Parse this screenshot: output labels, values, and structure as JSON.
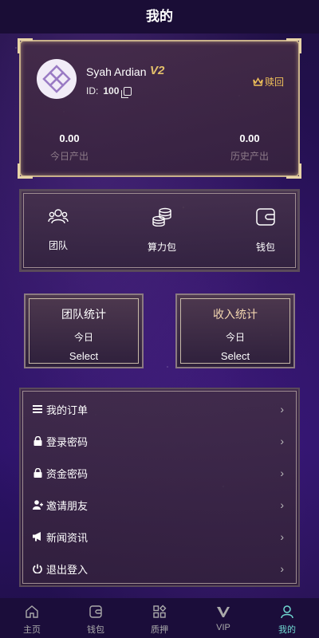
{
  "header": {
    "title": "我的"
  },
  "profile": {
    "name": "Syah Ardian",
    "vip_level": "V2",
    "id_label": "ID:",
    "id_value": "100",
    "reback_label": "赎回",
    "stats": [
      {
        "value": "0.00",
        "label": "今日产出"
      },
      {
        "value": "0.00",
        "label": "历史产出"
      }
    ]
  },
  "menu": [
    {
      "label": "团队",
      "icon": "team-icon"
    },
    {
      "label": "算力包",
      "icon": "coins-icon"
    },
    {
      "label": "钱包",
      "icon": "wallet-icon"
    }
  ],
  "stat_boxes": [
    {
      "title": "团队统计",
      "period": "今日",
      "select": "Select",
      "title_color": "#ffffff"
    },
    {
      "title": "收入统计",
      "period": "今日",
      "select": "Select",
      "title_color": "#f3d6b0"
    }
  ],
  "list": [
    {
      "label": "我的订单",
      "icon": "list-icon"
    },
    {
      "label": "登录密码",
      "icon": "lock-icon"
    },
    {
      "label": "资金密码",
      "icon": "lock-icon"
    },
    {
      "label": "邀请朋友",
      "icon": "add-user-icon"
    },
    {
      "label": "新闻资讯",
      "icon": "megaphone-icon"
    },
    {
      "label": "退出登入",
      "icon": "power-icon"
    }
  ],
  "tabs": [
    {
      "label": "主页",
      "icon": "home-icon",
      "active": false
    },
    {
      "label": "钱包",
      "icon": "wallet-icon",
      "active": false
    },
    {
      "label": "质押",
      "icon": "grid-icon",
      "active": false
    },
    {
      "label": "VIP",
      "icon": "vip-icon",
      "active": false
    },
    {
      "label": "我的",
      "icon": "user-icon",
      "active": true
    }
  ],
  "colors": {
    "accent": "#6fd7d0",
    "gold": "#f0c15a",
    "card_border": "#c8b08a"
  }
}
